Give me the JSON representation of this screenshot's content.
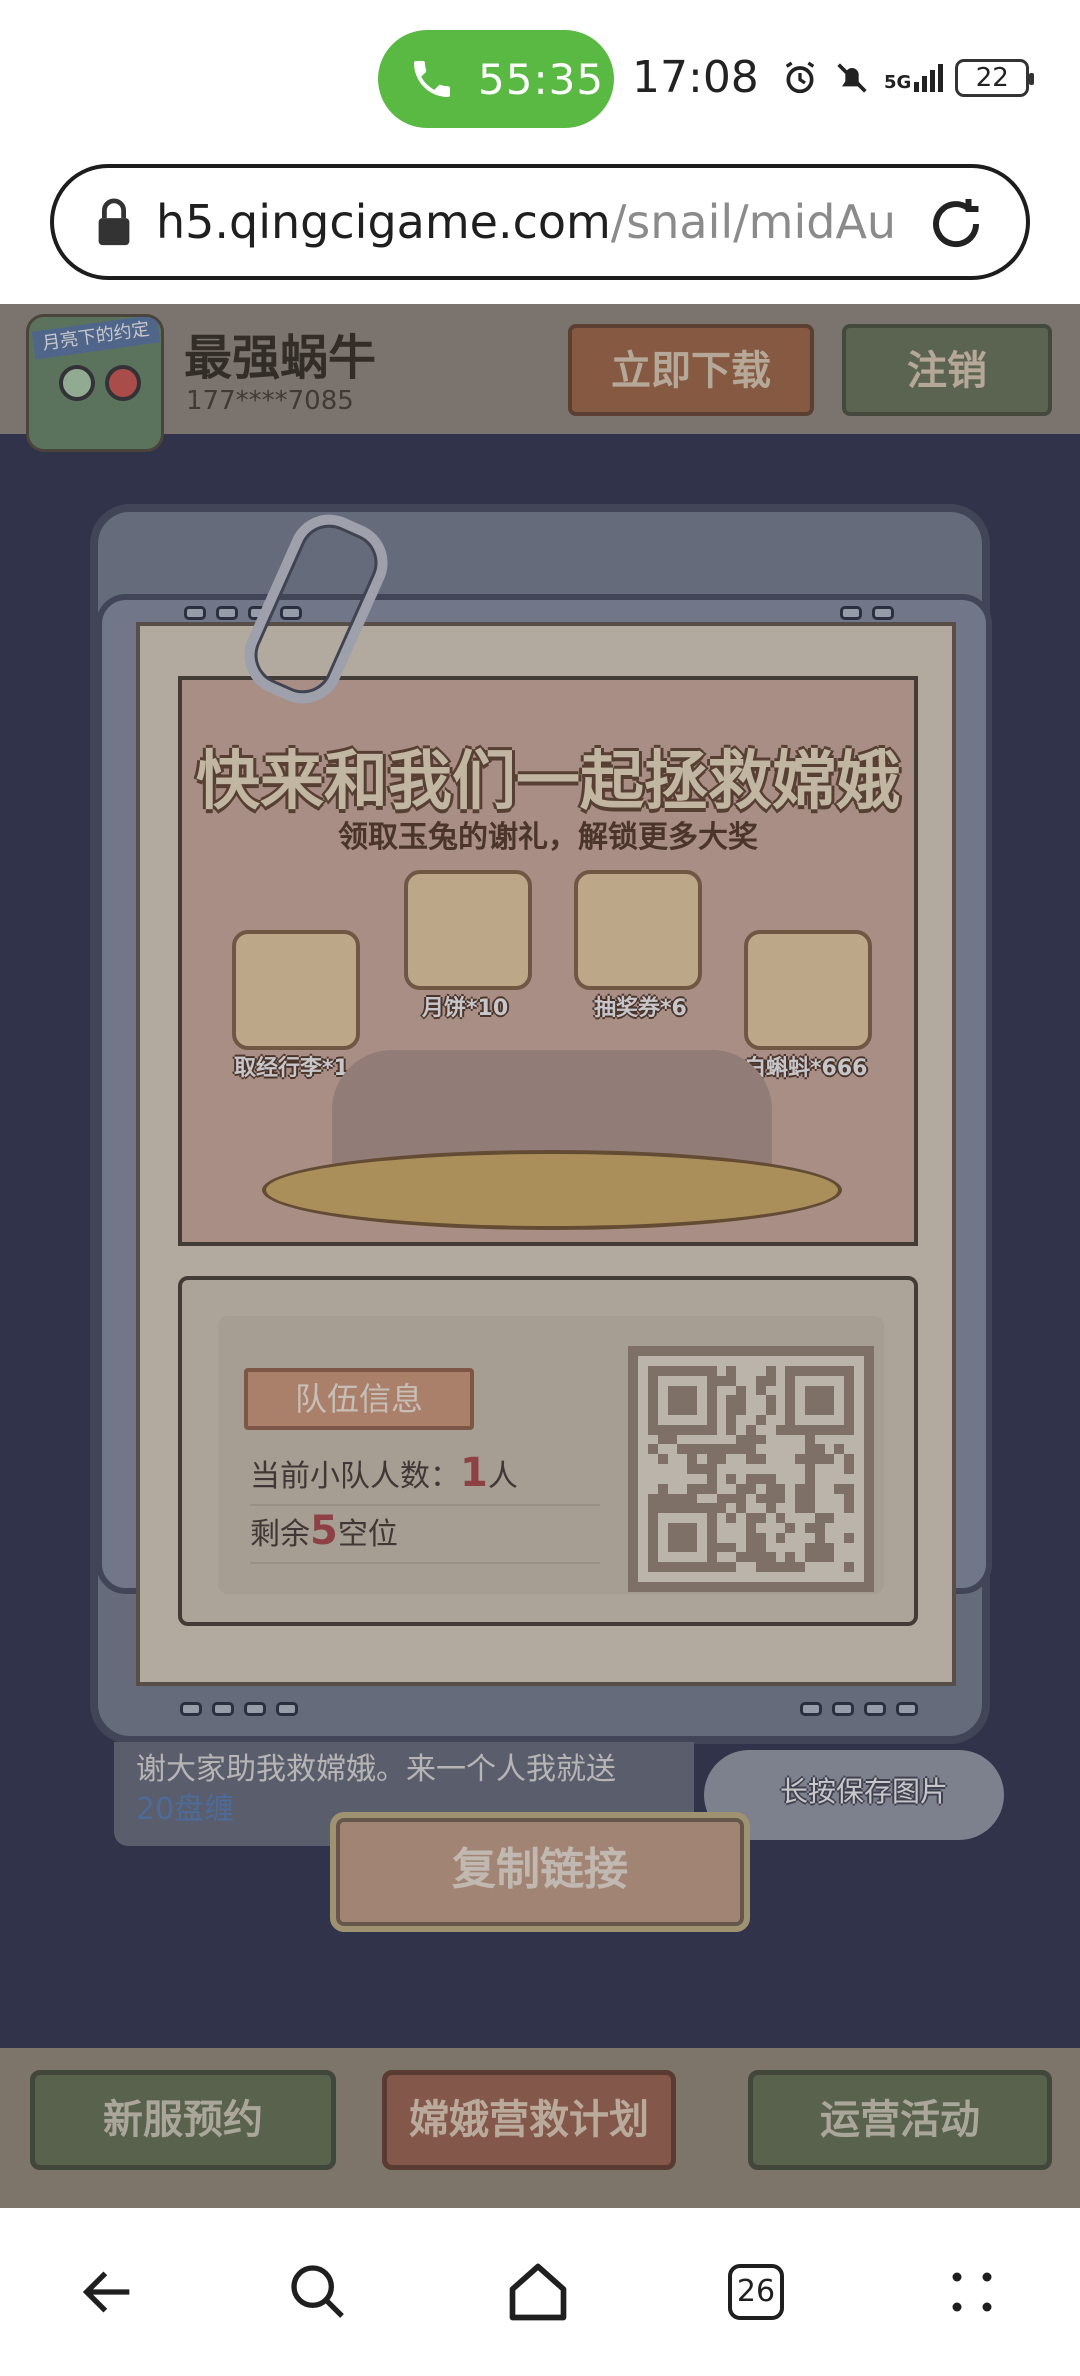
{
  "status_bar": {
    "call_timer": "55:35",
    "time": "17:08",
    "network": "5G",
    "battery": "22"
  },
  "browser": {
    "url_host": "h5.qingcigame.com",
    "url_path": "/snail/midAutu",
    "tab_count": "26"
  },
  "header": {
    "game_title": "最强蜗牛",
    "user_phone": "177****7085",
    "icon_banner": "月亮下的约定",
    "download_label": "立即下载",
    "logout_label": "注销"
  },
  "promo": {
    "title": "快来和我们一起拯救嫦娥",
    "subtitle": "领取玉兔的谢礼，解锁更多大奖",
    "rewards": [
      {
        "label": "取经行李*1"
      },
      {
        "label": "月饼*10"
      },
      {
        "label": "抽奖券*6"
      },
      {
        "label": "白蝌蚪*666"
      }
    ]
  },
  "team": {
    "badge": "队伍信息",
    "members_prefix": "当前小队人数：",
    "members_count": "1",
    "members_suffix": "人",
    "remaining_prefix": "剩余",
    "remaining_count": "5",
    "remaining_suffix": "空位"
  },
  "share": {
    "message_main": "谢大家助我救嫦娥。来一个人我就送",
    "message_highlight": "20盘缠",
    "save_hint": "长按保存图片",
    "copy_label": "复制链接"
  },
  "bottom_tabs": {
    "new_server": "新服预约",
    "rescue_plan": "嫦娥营救计划",
    "operations": "运营活动"
  },
  "icons": {
    "phone": "phone-icon",
    "lock": "lock-icon",
    "reload": "reload-icon",
    "back": "back-arrow-icon",
    "search": "search-icon",
    "home": "home-icon",
    "menu": "menu-dots-icon"
  },
  "colors": {
    "call_green": "#59b943",
    "page_bg": "#363a52",
    "accent_red": "#b24d4d"
  }
}
